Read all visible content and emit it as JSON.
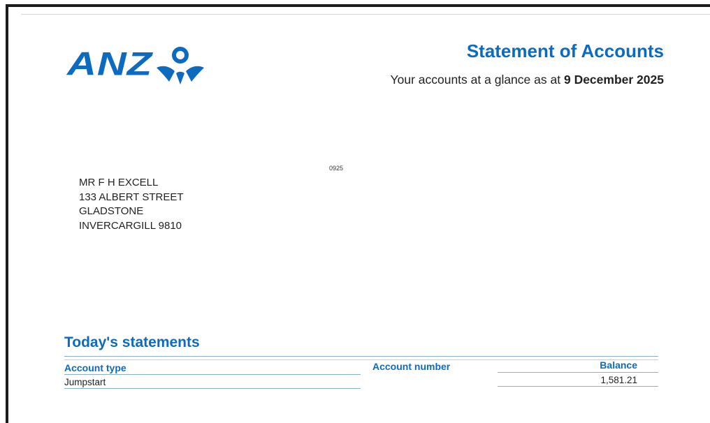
{
  "brand": {
    "logo_text": "ANZ",
    "logo_mark_icon": "anz-people-icon",
    "color": "#0d6bbf"
  },
  "header": {
    "title": "Statement of Accounts",
    "subtitle_prefix": "Your accounts at a glance as at",
    "date": "9 December 2025"
  },
  "doc_code": "0925",
  "address": {
    "lines": [
      "MR F H EXCELL",
      "133 ALBERT STREET",
      "GLADSTONE",
      "INVERCARGILL 9810"
    ]
  },
  "todays_statements": {
    "title": "Today's statements",
    "columns": {
      "account_type": "Account type",
      "account_number": "Account number",
      "balance": "Balance"
    },
    "rows": [
      {
        "account_type": "Jumpstart",
        "account_number": "",
        "balance": "1,581.21"
      }
    ]
  },
  "colors": {
    "accent": "#0d6bbf",
    "rule": "#88aed0",
    "frame": "#1c1c1c"
  }
}
